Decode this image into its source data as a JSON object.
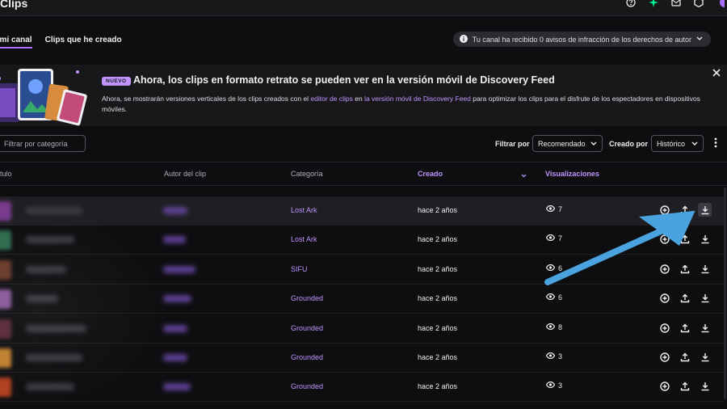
{
  "header": {
    "title": "Clips"
  },
  "tabs": [
    {
      "label": "De mi canal"
    },
    {
      "label": "Clips que he creado"
    }
  ],
  "strike_notice": "Tu canal ha recibido 0 avisos de infracción de los derechos de autor",
  "banner": {
    "badge": "NUEVO",
    "title": "Ahora, los clips en formato retrato se pueden ver en la versión móvil de Discovery Feed",
    "text_1": "Ahora, se mostrarán versiones verticales de los clips creados con el ",
    "link_1": "editor de clips",
    "text_2": " en ",
    "link_2": "la versión móvil de Discovery Feed",
    "text_3": " para optimizar los clips para el disfrute de los espectadores en dispositivos móviles."
  },
  "filters": {
    "search_placeholder": "Filtrar por categoría",
    "filter_label": "Filtrar por",
    "filter_value": "Recomendado",
    "created_label": "Creado por",
    "created_value": "Histórico"
  },
  "columns": {
    "title": "Título",
    "author": "Autor del clip",
    "category": "Categoría",
    "created": "Creado",
    "views": "Visualizaciones"
  },
  "rows": [
    {
      "category": "Lost Ark",
      "created": "hace 2 años",
      "views": "7"
    },
    {
      "category": "Lost Ark",
      "created": "hace 2 años",
      "views": "7"
    },
    {
      "category": "SIFU",
      "created": "hace 2 años",
      "views": "6"
    },
    {
      "category": "Grounded",
      "created": "hace 2 años",
      "views": "6"
    },
    {
      "category": "Grounded",
      "created": "hace 2 años",
      "views": "8"
    },
    {
      "category": "Grounded",
      "created": "hace 2 años",
      "views": "3"
    },
    {
      "category": "Grounded",
      "created": "hace 2 años",
      "views": "3"
    }
  ],
  "colors": {
    "accent": "#bf94ff",
    "tab_underline": "#a970ff",
    "annotation_arrow": "#4aa3df"
  },
  "icons": [
    "help-icon",
    "gem-icon",
    "mail-icon",
    "settings-icon",
    "info-icon",
    "close-icon",
    "eye-icon",
    "add-circle-icon",
    "share-icon",
    "download-icon"
  ]
}
